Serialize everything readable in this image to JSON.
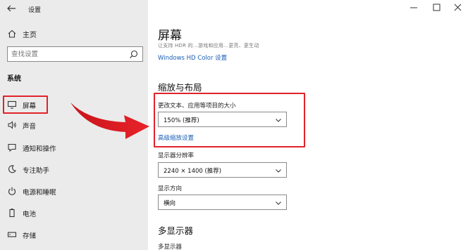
{
  "window": {
    "title": "设置"
  },
  "sidebar": {
    "home_label": "主页",
    "search_placeholder": "查找设置",
    "section_title": "系统",
    "items": [
      {
        "label": "屏幕",
        "icon": "monitor-icon",
        "active": true
      },
      {
        "label": "声音",
        "icon": "speaker-icon"
      },
      {
        "label": "通知和操作",
        "icon": "notification-icon"
      },
      {
        "label": "专注助手",
        "icon": "moon-icon"
      },
      {
        "label": "电源和睡眠",
        "icon": "power-icon"
      },
      {
        "label": "电池",
        "icon": "battery-icon"
      },
      {
        "label": "存储",
        "icon": "storage-icon"
      }
    ]
  },
  "main": {
    "title": "屏幕",
    "description": "让支持 HDR 的...游戏和应用...更亮、更生动",
    "hdr_link": "Windows HD Color 设置",
    "scale_section": "缩放与布局",
    "scale_label": "更改文本、应用等项目的大小",
    "scale_value": "150% (推荐)",
    "advanced_scaling_link": "高级缩放设置",
    "resolution_label": "显示器分辨率",
    "resolution_value": "2240 × 1400 (推荐)",
    "orientation_label": "显示方向",
    "orientation_value": "横向",
    "multi_display_section": "多显示器",
    "multi_display_sub": "多显示器"
  },
  "colors": {
    "accent": "#1a5fb4",
    "highlight": "#e0232a",
    "sidebar_bg": "#ebebeb"
  }
}
